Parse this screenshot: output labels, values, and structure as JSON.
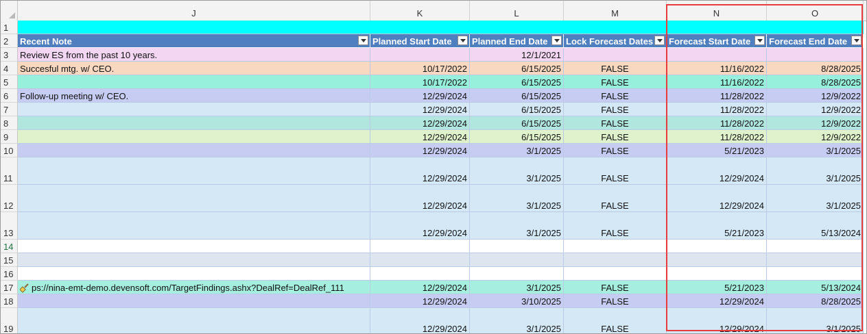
{
  "columns": [
    "J",
    "K",
    "L",
    "M",
    "N",
    "O"
  ],
  "table_headers": [
    "Recent Note",
    "Planned Start Date",
    "Planned End Date",
    "Lock Forecast Dates",
    "Forecast Start Date",
    "Forecast End Date"
  ],
  "rows": [
    {
      "num": "1",
      "cells": [
        "",
        "",
        "",
        "",
        "",
        ""
      ]
    },
    {
      "num": "2",
      "cells": [
        "",
        "",
        "",
        "",
        "",
        ""
      ]
    },
    {
      "num": "3",
      "cells": [
        "Review ES from the past 10 years.",
        "",
        "12/1/2021",
        "",
        "",
        ""
      ]
    },
    {
      "num": "4",
      "cells": [
        "Succesful mtg. w/ CEO.",
        "10/17/2022",
        "6/15/2025",
        "FALSE",
        "11/16/2022",
        "8/28/2025"
      ]
    },
    {
      "num": "5",
      "cells": [
        "",
        "10/17/2022",
        "6/15/2025",
        "FALSE",
        "11/16/2022",
        "8/28/2025"
      ]
    },
    {
      "num": "6",
      "cells": [
        "Follow-up meeting w/ CEO.",
        "12/29/2024",
        "6/15/2025",
        "FALSE",
        "11/28/2022",
        "12/9/2022"
      ]
    },
    {
      "num": "7",
      "cells": [
        "",
        "12/29/2024",
        "6/15/2025",
        "FALSE",
        "11/28/2022",
        "12/9/2022"
      ]
    },
    {
      "num": "8",
      "cells": [
        "",
        "12/29/2024",
        "6/15/2025",
        "FALSE",
        "11/28/2022",
        "12/9/2022"
      ]
    },
    {
      "num": "9",
      "cells": [
        "",
        "12/29/2024",
        "6/15/2025",
        "FALSE",
        "11/28/2022",
        "12/9/2022"
      ]
    },
    {
      "num": "10",
      "cells": [
        "",
        "12/29/2024",
        "3/1/2025",
        "FALSE",
        "5/21/2023",
        "3/1/2025"
      ]
    },
    {
      "num": "11",
      "cells": [
        "",
        "12/29/2024",
        "3/1/2025",
        "FALSE",
        "12/29/2024",
        "3/1/2025"
      ]
    },
    {
      "num": "12",
      "cells": [
        "",
        "12/29/2024",
        "3/1/2025",
        "FALSE",
        "12/29/2024",
        "3/1/2025"
      ]
    },
    {
      "num": "13",
      "cells": [
        "",
        "12/29/2024",
        "3/1/2025",
        "FALSE",
        "5/21/2023",
        "5/13/2024"
      ]
    },
    {
      "num": "14",
      "cells": [
        "",
        "",
        "",
        "",
        "",
        ""
      ]
    },
    {
      "num": "15",
      "cells": [
        "",
        "",
        "",
        "",
        "",
        ""
      ]
    },
    {
      "num": "16",
      "cells": [
        "",
        "",
        "",
        "",
        "",
        ""
      ]
    },
    {
      "num": "17",
      "cells": [
        "ps://nina-emt-demo.devensoft.com/TargetFindings.ashx?DealRef=DealRef_111",
        "12/29/2024",
        "3/1/2025",
        "FALSE",
        "5/21/2023",
        "5/13/2024"
      ]
    },
    {
      "num": "18",
      "cells": [
        "",
        "12/29/2024",
        "3/10/2025",
        "FALSE",
        "12/29/2024",
        "8/28/2025"
      ]
    },
    {
      "num": "19",
      "cells": [
        "",
        "12/29/2024",
        "3/1/2025",
        "FALSE",
        "12/29/2024",
        "3/1/2025"
      ]
    }
  ],
  "colors": {
    "header_blue": "#4f7fbf",
    "cyan": "#00ffff",
    "highlight_red": "#e83b3b"
  }
}
